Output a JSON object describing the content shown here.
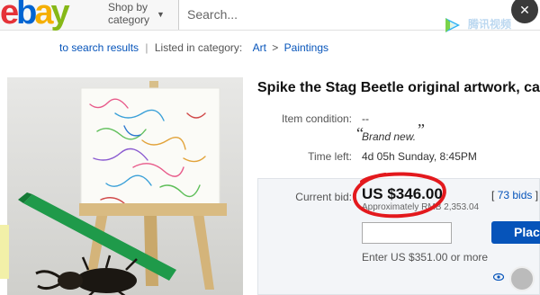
{
  "header": {
    "logo_letters": [
      "e",
      "b",
      "a",
      "y"
    ],
    "shop_by": "Shop by",
    "category": "category",
    "search_placeholder": "Search..."
  },
  "video_overlay": {
    "watermark": "腾讯视频"
  },
  "breadcrumb": {
    "back": "to search results",
    "listed": "Listed in category:",
    "cat1": "Art",
    "sep": ">",
    "cat2": "Paintings"
  },
  "listing": {
    "title": "Spike the Stag Beetle original artwork, ca",
    "condition_label": "Item condition:",
    "condition_value": "--",
    "condition_quote": "Brand new.",
    "time_left_label": "Time left:",
    "time_left_value": "4d 05h Sunday, 8:45PM",
    "current_bid_label": "Current bid:",
    "current_bid": "US $346.00",
    "approx": "Approximately RMB 2,353.04",
    "bids_prefix": "[",
    "bids_link": "73 bids",
    "bids_suffix": "]",
    "place_bid": "Plac",
    "enter": "Enter US $351.00 or more"
  },
  "colors": {
    "ebay_red": "#e53238",
    "ebay_blue": "#0064d2",
    "ebay_yellow": "#f5af02",
    "ebay_green": "#86b817",
    "link": "#0654ba",
    "annotation": "#e3191d"
  },
  "icons": [
    "chevron-down-icon",
    "video-logo-icon",
    "eye-icon",
    "close-icon"
  ]
}
